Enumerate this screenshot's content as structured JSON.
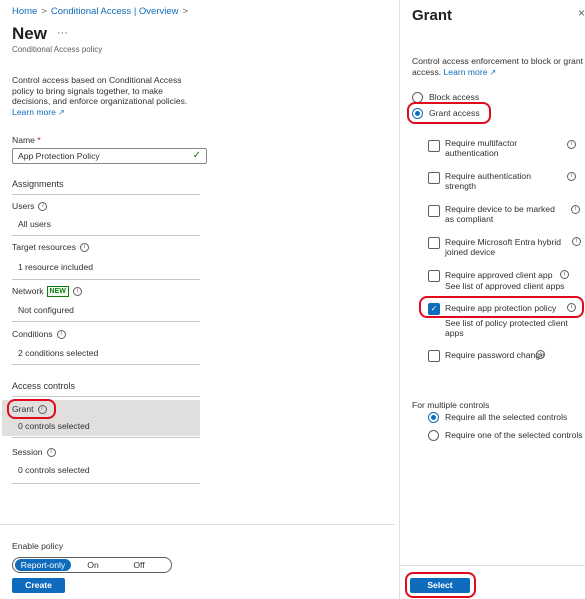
{
  "breadcrumb": {
    "home": "Home",
    "section": "Conditional Access | Overview",
    "sep": ">"
  },
  "header": {
    "title": "New",
    "more": "···",
    "subtitle": "Conditional Access policy"
  },
  "description": {
    "text": "Control access based on Conditional Access policy to bring signals together, to make decisions, and enforce organizational policies.",
    "learn_more": "Learn more"
  },
  "name_field": {
    "label": "Name",
    "required": "*",
    "value": "App Protection Policy"
  },
  "assignments": {
    "heading": "Assignments",
    "users_label": "Users",
    "users_value": "All users",
    "target_label": "Target resources",
    "target_value": "1 resource included",
    "network_label": "Network",
    "network_badge": "NEW",
    "network_value": "Not configured",
    "conditions_label": "Conditions",
    "conditions_value": "2 conditions selected"
  },
  "access_controls": {
    "heading": "Access controls",
    "grant_label": "Grant",
    "grant_value": "0 controls selected",
    "session_label": "Session",
    "session_value": "0 controls selected"
  },
  "enable_policy": {
    "label": "Enable policy",
    "options": [
      "Report-only",
      "On",
      "Off"
    ],
    "selected": "Report-only"
  },
  "create_button": "Create",
  "grant_panel": {
    "title": "Grant",
    "close": "×",
    "intro": "Control access enforcement to block or grant access.",
    "learn_more": "Learn more",
    "block_access": "Block access",
    "grant_access": "Grant access",
    "controls": [
      {
        "label": "Require multifactor authentication",
        "checked": false
      },
      {
        "label": "Require authentication strength",
        "checked": false
      },
      {
        "label": "Require device to be marked as compliant",
        "checked": false
      },
      {
        "label": "Require Microsoft Entra hybrid joined device",
        "checked": false
      },
      {
        "label": "Require approved client app",
        "link": "See list of approved client apps",
        "checked": false
      },
      {
        "label": "Require app protection policy",
        "link": "See list of policy protected client apps",
        "checked": true
      },
      {
        "label": "Require password change",
        "checked": false
      }
    ],
    "multiple_label": "For multiple controls",
    "require_all": "Require all the selected controls",
    "require_one": "Require one of the selected controls",
    "select_button": "Select"
  },
  "colors": {
    "accent": "#0f6cbd",
    "highlight": "#e00b1c",
    "selected_row": "#e1dfdd"
  }
}
